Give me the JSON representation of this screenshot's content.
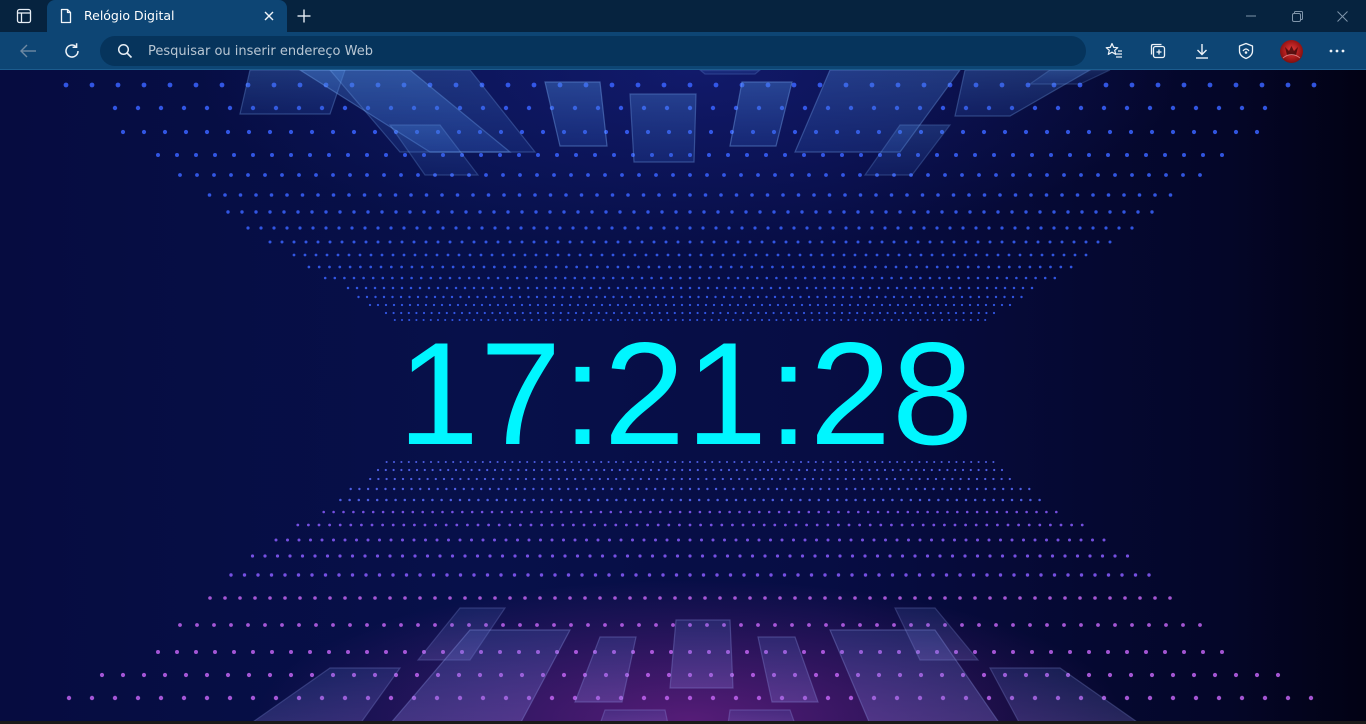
{
  "browser": {
    "tab": {
      "title": "Relógio Digital",
      "favicon": "page-icon"
    },
    "address_bar": {
      "placeholder": "Pesquisar ou inserir endereço Web",
      "value": ""
    },
    "toolbar_icons": [
      "back-icon",
      "refresh-icon",
      "search-icon",
      "favorites-icon",
      "collections-icon",
      "download-icon",
      "browser-essentials-icon",
      "avatar",
      "more-icon"
    ],
    "window_controls": [
      "minimize-icon",
      "restore-icon",
      "close-icon"
    ]
  },
  "clock": {
    "time": "17:21:28"
  },
  "colors": {
    "tabstrip": "#06233f",
    "toolbar": "#0d4574",
    "clock_text": "#00f6ff",
    "background": "#07104a"
  }
}
